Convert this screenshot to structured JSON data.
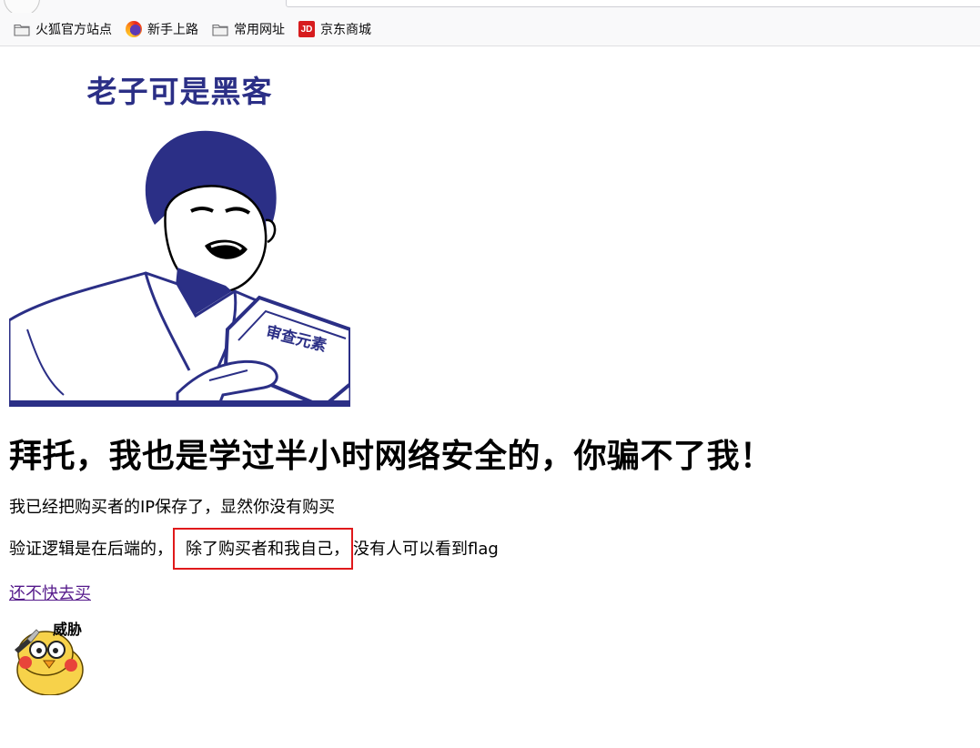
{
  "bookmarks": [
    {
      "label": "火狐官方站点",
      "icon": "folder-icon"
    },
    {
      "label": "新手上路",
      "icon": "firefox-icon"
    },
    {
      "label": "常用网址",
      "icon": "folder-icon"
    },
    {
      "label": "京东商城",
      "icon": "jd-icon"
    }
  ],
  "page": {
    "meme_caption": "老子可是黑客",
    "meme_book_text": "审查元素",
    "heading": "拜托，我也是学过半小时网络安全的，你骗不了我！",
    "line1": "我已经把购买者的IP保存了，显然你没有购买",
    "line2_prefix": "验证逻辑是在后端的，",
    "line2_highlight": "除了购买者和我自己，",
    "line2_suffix": "没有人可以看到flag",
    "buy_link": "还不快去买",
    "sticker_label": "威胁"
  },
  "colors": {
    "meme_ink": "#2b2f86",
    "highlight_box": "#e0191b",
    "visited_link": "#551a8b",
    "jd_brand": "#d71c1e"
  }
}
